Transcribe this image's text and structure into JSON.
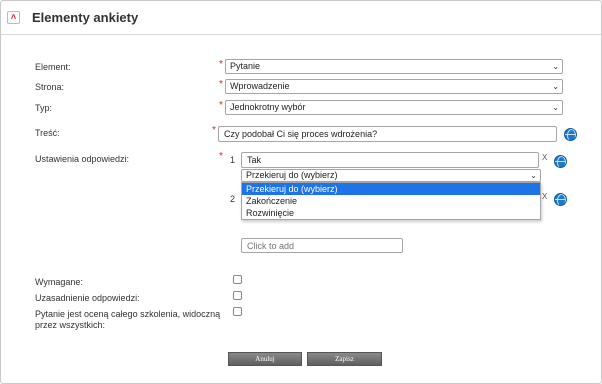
{
  "header": {
    "title": "Elementy ankiety",
    "collapse_glyph": "˄"
  },
  "form": {
    "element": {
      "label": "Element:",
      "value": "Pytanie"
    },
    "strona": {
      "label": "Strona:",
      "value": "Wprowadzenie"
    },
    "typ": {
      "label": "Typ:",
      "value": "Jednokrotny wybór"
    },
    "tresc": {
      "label": "Treść:",
      "value": "Czy podobał Ci się proces wdrożenia?"
    },
    "ustawienia": {
      "label": "Ustawienia odpowiedzi:",
      "answers": [
        {
          "number": "1",
          "value": "Tak",
          "action": "Przekieruj do (wybierz)"
        },
        {
          "number": "2"
        }
      ],
      "dropdown_options": [
        "Przekieruj do (wybierz)",
        "Zakończenie",
        "Rozwinięcie"
      ],
      "click_to_add_placeholder": "Click to add",
      "remove_glyph": "X"
    },
    "checkboxes": [
      {
        "label": "Wymagane:",
        "checked": false
      },
      {
        "label": "Uzasadnienie odpowiedzi:",
        "checked": false
      },
      {
        "label_line1": "Pytanie jest oceną całego szkolenia, widoczną",
        "label_line2": "przez wszystkich:",
        "checked": false
      }
    ],
    "required_mark": "*",
    "dropdown_arrow": "⌄"
  },
  "buttons": {
    "cancel": "Anuluj",
    "save": "Zapisz"
  },
  "colors": {
    "required": "#dd2222",
    "selected_option": "#1e73e8",
    "globe": "#1f78c8"
  }
}
